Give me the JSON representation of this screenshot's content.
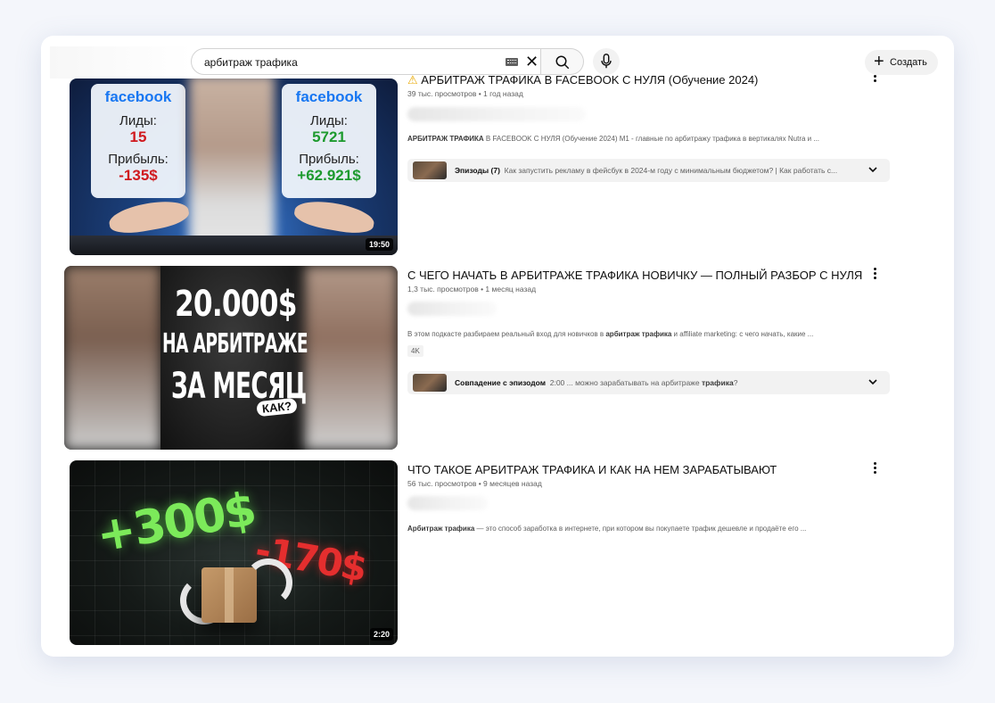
{
  "header": {
    "search_value": "арбитраж трафика",
    "create_label": "Создать"
  },
  "results": [
    {
      "title": "АРБИТРАЖ ТРАФИКА В FACEBOOK С НУЛЯ (Обучение 2024)",
      "meta": "39 тыс. просмотров • 1 год назад",
      "desc_bold": "АРБИТРАЖ ТРАФИКА",
      "desc_rest": " В FACEBOOK С НУЛЯ (Обучение 2024) M1 - главные по арбитражу трафика в вертикалях Nutra и ...",
      "duration": "19:50",
      "chapter_label": "Эпизоды (7)",
      "chapter_text": "Как запустить рекламу в фейсбук в 2024-м году с минимальным бюджетом? | Как работать с...",
      "thumb": {
        "brand": "facebook",
        "leads_label": "Лиды:",
        "profit_label": "Прибыль:",
        "left_leads": "15",
        "left_profit": "-135$",
        "right_leads": "5721",
        "right_profit": "+62.921$"
      }
    },
    {
      "title": "С ЧЕГО НАЧАТЬ В АРБИТРАЖЕ ТРАФИКА НОВИЧКУ — ПОЛНЫЙ РАЗБОР С НУЛЯ",
      "meta": "1,3 тыс. просмотров • 1 месяц назад",
      "desc_start": "В этом подкасте разбираем реальный вход для новичков в ",
      "desc_bold": "арбитраж трафика",
      "desc_rest": " и affiliate marketing: с чего начать, какие ...",
      "badge": "4K",
      "chapter_label": "Совпадение с эпизодом",
      "chapter_text_start": "2:00 ... можно зарабатывать на арбитраже ",
      "chapter_text_bold": "трафика",
      "chapter_text_end": "?",
      "thumb": {
        "line1": "20.000$",
        "line2": "НА АРБИТРАЖЕ",
        "line3": "ЗА МЕСЯЦ",
        "tag": "КАК?"
      }
    },
    {
      "title": "ЧТО ТАКОЕ АРБИТРАЖ ТРАФИКА И КАК НА НЕМ ЗАРАБАТЫВАЮТ",
      "meta": "56 тыс. просмотров • 9 месяцев назад",
      "desc_bold": "Арбитраж трафика",
      "desc_rest": " — это способ заработка в интернете, при котором вы покупаете трафик дешевле и продаёте его ...",
      "duration": "2:20",
      "thumb": {
        "plus": "+300$",
        "minus": "-170$"
      }
    }
  ],
  "colors": {
    "facebook_blue": "#1877f2",
    "loss_red": "#d0191e",
    "gain_green": "#1d9a2e"
  }
}
